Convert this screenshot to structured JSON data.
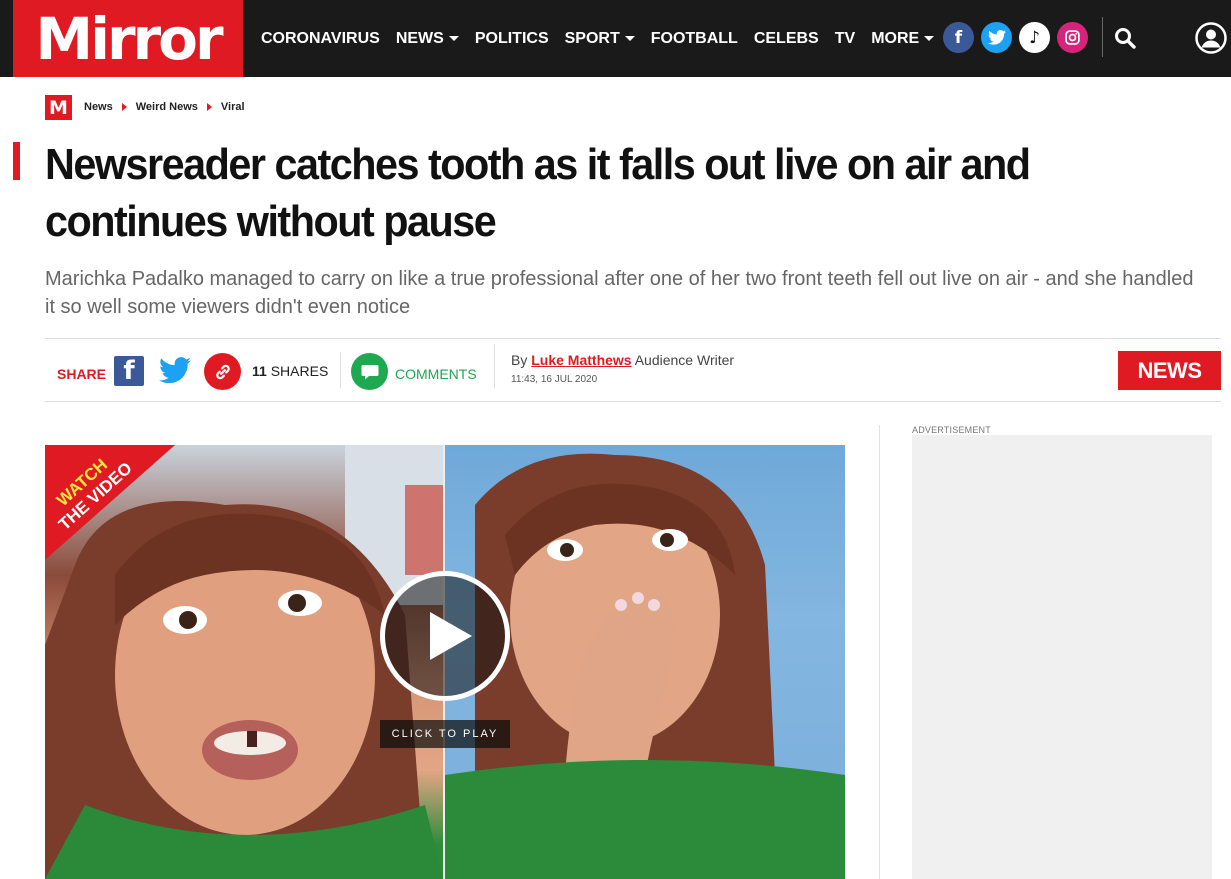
{
  "header": {
    "logo": "Mirror",
    "nav": [
      {
        "label": "CORONAVIRUS",
        "dropdown": false
      },
      {
        "label": "NEWS",
        "dropdown": true
      },
      {
        "label": "POLITICS",
        "dropdown": false
      },
      {
        "label": "SPORT",
        "dropdown": true
      },
      {
        "label": "FOOTBALL",
        "dropdown": false
      },
      {
        "label": "CELEBS",
        "dropdown": false
      },
      {
        "label": "TV",
        "dropdown": false
      },
      {
        "label": "MORE",
        "dropdown": true
      }
    ],
    "social": {
      "facebook": "f",
      "twitter": "twitter-bird-icon",
      "tiktok": "♪",
      "instagram": "instagram-icon"
    },
    "colors": {
      "brand_red": "#e01a22",
      "bar_bg": "#1a1a1a"
    }
  },
  "breadcrumb": {
    "logo": "M",
    "items": [
      "News",
      "Weird News",
      "Viral"
    ]
  },
  "article": {
    "headline": "Newsreader catches tooth as it falls out live on air and continues without pause",
    "standfirst": "Marichka Padalko managed to carry on like a true professional after one of her two front teeth fell out live on air - and she handled it so well some viewers didn't even notice"
  },
  "share": {
    "label": "SHARE",
    "count": "11",
    "count_suffix": "SHARES",
    "comments_label": "COMMENTS"
  },
  "byline": {
    "by": "By",
    "author": "Luke Matthews",
    "role": "Audience Writer",
    "timestamp": "11:43, 16 JUL 2020"
  },
  "section_badge": "NEWS",
  "video": {
    "ribbon_line1": "WATCH",
    "ribbon_line2": "THE VIDEO",
    "click_label": "CLICK TO PLAY"
  },
  "sidebar": {
    "ad_label": "ADVERTISEMENT"
  }
}
